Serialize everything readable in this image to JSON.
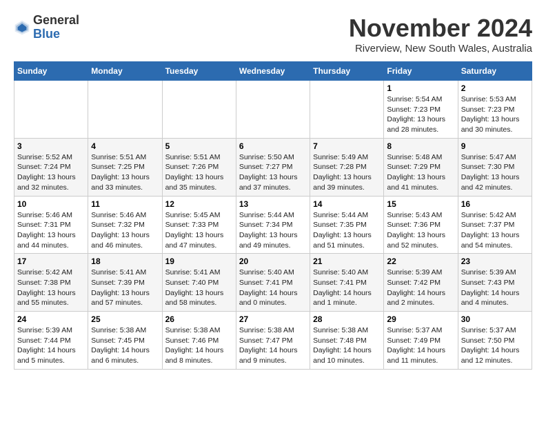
{
  "header": {
    "logo_line1": "General",
    "logo_line2": "Blue",
    "month": "November 2024",
    "location": "Riverview, New South Wales, Australia"
  },
  "weekdays": [
    "Sunday",
    "Monday",
    "Tuesday",
    "Wednesday",
    "Thursday",
    "Friday",
    "Saturday"
  ],
  "weeks": [
    [
      {
        "day": "",
        "info": ""
      },
      {
        "day": "",
        "info": ""
      },
      {
        "day": "",
        "info": ""
      },
      {
        "day": "",
        "info": ""
      },
      {
        "day": "",
        "info": ""
      },
      {
        "day": "1",
        "info": "Sunrise: 5:54 AM\nSunset: 7:23 PM\nDaylight: 13 hours\nand 28 minutes."
      },
      {
        "day": "2",
        "info": "Sunrise: 5:53 AM\nSunset: 7:23 PM\nDaylight: 13 hours\nand 30 minutes."
      }
    ],
    [
      {
        "day": "3",
        "info": "Sunrise: 5:52 AM\nSunset: 7:24 PM\nDaylight: 13 hours\nand 32 minutes."
      },
      {
        "day": "4",
        "info": "Sunrise: 5:51 AM\nSunset: 7:25 PM\nDaylight: 13 hours\nand 33 minutes."
      },
      {
        "day": "5",
        "info": "Sunrise: 5:51 AM\nSunset: 7:26 PM\nDaylight: 13 hours\nand 35 minutes."
      },
      {
        "day": "6",
        "info": "Sunrise: 5:50 AM\nSunset: 7:27 PM\nDaylight: 13 hours\nand 37 minutes."
      },
      {
        "day": "7",
        "info": "Sunrise: 5:49 AM\nSunset: 7:28 PM\nDaylight: 13 hours\nand 39 minutes."
      },
      {
        "day": "8",
        "info": "Sunrise: 5:48 AM\nSunset: 7:29 PM\nDaylight: 13 hours\nand 41 minutes."
      },
      {
        "day": "9",
        "info": "Sunrise: 5:47 AM\nSunset: 7:30 PM\nDaylight: 13 hours\nand 42 minutes."
      }
    ],
    [
      {
        "day": "10",
        "info": "Sunrise: 5:46 AM\nSunset: 7:31 PM\nDaylight: 13 hours\nand 44 minutes."
      },
      {
        "day": "11",
        "info": "Sunrise: 5:46 AM\nSunset: 7:32 PM\nDaylight: 13 hours\nand 46 minutes."
      },
      {
        "day": "12",
        "info": "Sunrise: 5:45 AM\nSunset: 7:33 PM\nDaylight: 13 hours\nand 47 minutes."
      },
      {
        "day": "13",
        "info": "Sunrise: 5:44 AM\nSunset: 7:34 PM\nDaylight: 13 hours\nand 49 minutes."
      },
      {
        "day": "14",
        "info": "Sunrise: 5:44 AM\nSunset: 7:35 PM\nDaylight: 13 hours\nand 51 minutes."
      },
      {
        "day": "15",
        "info": "Sunrise: 5:43 AM\nSunset: 7:36 PM\nDaylight: 13 hours\nand 52 minutes."
      },
      {
        "day": "16",
        "info": "Sunrise: 5:42 AM\nSunset: 7:37 PM\nDaylight: 13 hours\nand 54 minutes."
      }
    ],
    [
      {
        "day": "17",
        "info": "Sunrise: 5:42 AM\nSunset: 7:38 PM\nDaylight: 13 hours\nand 55 minutes."
      },
      {
        "day": "18",
        "info": "Sunrise: 5:41 AM\nSunset: 7:39 PM\nDaylight: 13 hours\nand 57 minutes."
      },
      {
        "day": "19",
        "info": "Sunrise: 5:41 AM\nSunset: 7:40 PM\nDaylight: 13 hours\nand 58 minutes."
      },
      {
        "day": "20",
        "info": "Sunrise: 5:40 AM\nSunset: 7:41 PM\nDaylight: 14 hours\nand 0 minutes."
      },
      {
        "day": "21",
        "info": "Sunrise: 5:40 AM\nSunset: 7:41 PM\nDaylight: 14 hours\nand 1 minute."
      },
      {
        "day": "22",
        "info": "Sunrise: 5:39 AM\nSunset: 7:42 PM\nDaylight: 14 hours\nand 2 minutes."
      },
      {
        "day": "23",
        "info": "Sunrise: 5:39 AM\nSunset: 7:43 PM\nDaylight: 14 hours\nand 4 minutes."
      }
    ],
    [
      {
        "day": "24",
        "info": "Sunrise: 5:39 AM\nSunset: 7:44 PM\nDaylight: 14 hours\nand 5 minutes."
      },
      {
        "day": "25",
        "info": "Sunrise: 5:38 AM\nSunset: 7:45 PM\nDaylight: 14 hours\nand 6 minutes."
      },
      {
        "day": "26",
        "info": "Sunrise: 5:38 AM\nSunset: 7:46 PM\nDaylight: 14 hours\nand 8 minutes."
      },
      {
        "day": "27",
        "info": "Sunrise: 5:38 AM\nSunset: 7:47 PM\nDaylight: 14 hours\nand 9 minutes."
      },
      {
        "day": "28",
        "info": "Sunrise: 5:38 AM\nSunset: 7:48 PM\nDaylight: 14 hours\nand 10 minutes."
      },
      {
        "day": "29",
        "info": "Sunrise: 5:37 AM\nSunset: 7:49 PM\nDaylight: 14 hours\nand 11 minutes."
      },
      {
        "day": "30",
        "info": "Sunrise: 5:37 AM\nSunset: 7:50 PM\nDaylight: 14 hours\nand 12 minutes."
      }
    ]
  ]
}
